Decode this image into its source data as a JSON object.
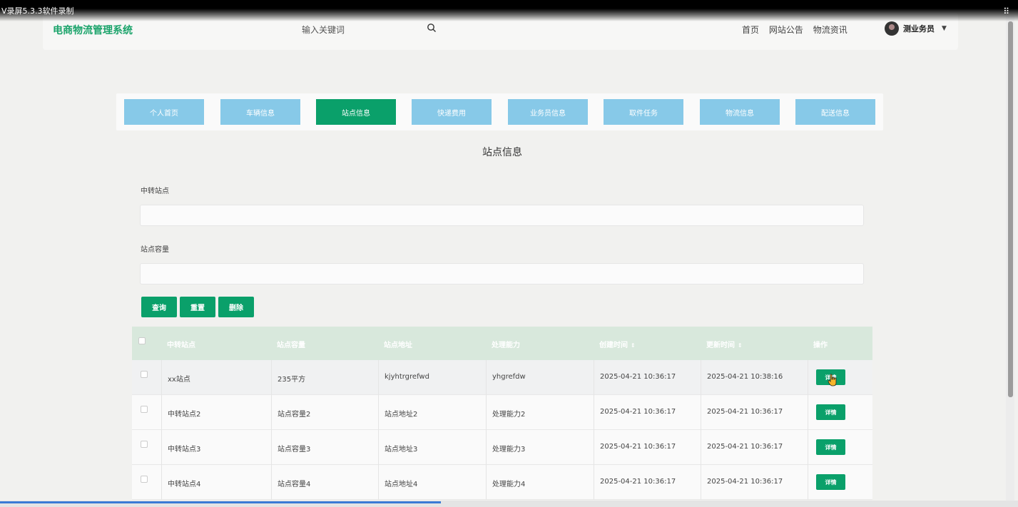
{
  "recorder": {
    "title": "V录屏5.3.3软件录制"
  },
  "header": {
    "logo": "电商物流管理系统",
    "search_placeholder": "输入关键词",
    "links": [
      "首页",
      "网站公告",
      "物流资讯"
    ],
    "user_name": "测业务员"
  },
  "tabs": [
    {
      "label": "个人首页"
    },
    {
      "label": "车辆信息"
    },
    {
      "label": "站点信息"
    },
    {
      "label": "快递费用"
    },
    {
      "label": "业务员信息"
    },
    {
      "label": "取件任务"
    },
    {
      "label": "物流信息"
    },
    {
      "label": "配送信息"
    }
  ],
  "active_tab": "站点信息",
  "page_title": "站点信息",
  "filters": {
    "transfer_station_label": "中转站点",
    "transfer_station_value": "",
    "capacity_label": "站点容量",
    "capacity_value": ""
  },
  "buttons": {
    "query": "查询",
    "reset": "重置",
    "delete": "删除"
  },
  "table": {
    "headers": [
      "中转站点",
      "站点容量",
      "站点地址",
      "处理能力",
      "创建时间",
      "更新时间",
      "操作"
    ],
    "rows": [
      {
        "station": "xx站点",
        "capacity": "235平方",
        "address": "kjyhtrgrefwd",
        "ability": "yhgrefdw",
        "created": "2025-04-21 10:36:17",
        "updated": "2025-04-21 10:38:16",
        "action": "详情"
      },
      {
        "station": "中转站点2",
        "capacity": "站点容量2",
        "address": "站点地址2",
        "ability": "处理能力2",
        "created": "2025-04-21 10:36:17",
        "updated": "2025-04-21 10:36:17",
        "action": "详情"
      },
      {
        "station": "中转站点3",
        "capacity": "站点容量3",
        "address": "站点地址3",
        "ability": "处理能力3",
        "created": "2025-04-21 10:36:17",
        "updated": "2025-04-21 10:36:17",
        "action": "详情"
      },
      {
        "station": "中转站点4",
        "capacity": "站点容量4",
        "address": "站点地址4",
        "ability": "处理能力4",
        "created": "2025-04-21 10:36:17",
        "updated": "2025-04-21 10:36:17",
        "action": "详情"
      }
    ]
  },
  "colors": {
    "primary": "#0aa06a",
    "tab": "#87c9e8",
    "table_header": "#d8e8dc",
    "logo": "#1aa36a"
  },
  "icons": {
    "search": "search-icon",
    "caret": "chevron-down-icon",
    "sort": "sort-icon"
  }
}
